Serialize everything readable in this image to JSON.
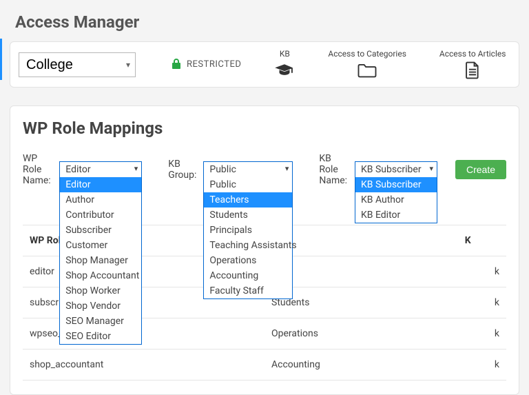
{
  "page_title": "Access Manager",
  "toolbar": {
    "kb_selected": "College",
    "restricted_label": "RESTRICTED",
    "tabs": {
      "kb": "KB",
      "categories": "Access to Categories",
      "articles": "Access to Articles"
    }
  },
  "panel": {
    "title": "WP Role Mappings",
    "wp_role_label": "WP Role Name:",
    "wp_role_selected": "Editor",
    "wp_role_options": [
      "Editor",
      "Author",
      "Contributor",
      "Subscriber",
      "Customer",
      "Shop Manager",
      "Shop Accountant",
      "Shop Worker",
      "Shop Vendor",
      "SEO Manager",
      "SEO Editor"
    ],
    "kb_group_label": "KB Group:",
    "kb_group_selected": "Public",
    "kb_group_highlight": "Teachers",
    "kb_group_options": [
      "Public",
      "Teachers",
      "Students",
      "Principals",
      "Teaching Assistants",
      "Operations",
      "Accounting",
      "Faculty Staff"
    ],
    "kb_role_label": "KB Role Name:",
    "kb_role_selected": "KB Subscriber",
    "kb_role_options": [
      "KB Subscriber",
      "KB Author",
      "KB Editor"
    ],
    "create_label": "Create",
    "table": {
      "head_wp_role": "WP Role",
      "head_kb": "K",
      "rows": [
        {
          "wp_role": "editor",
          "kb_group": "",
          "kb": "k"
        },
        {
          "wp_role": "subscriber",
          "kb_group": "Students",
          "kb": "k"
        },
        {
          "wp_role": "wpseo_editor",
          "kb_group": "Operations",
          "kb": "k"
        },
        {
          "wp_role": "shop_accountant",
          "kb_group": "Accounting",
          "kb": "k"
        }
      ]
    }
  }
}
